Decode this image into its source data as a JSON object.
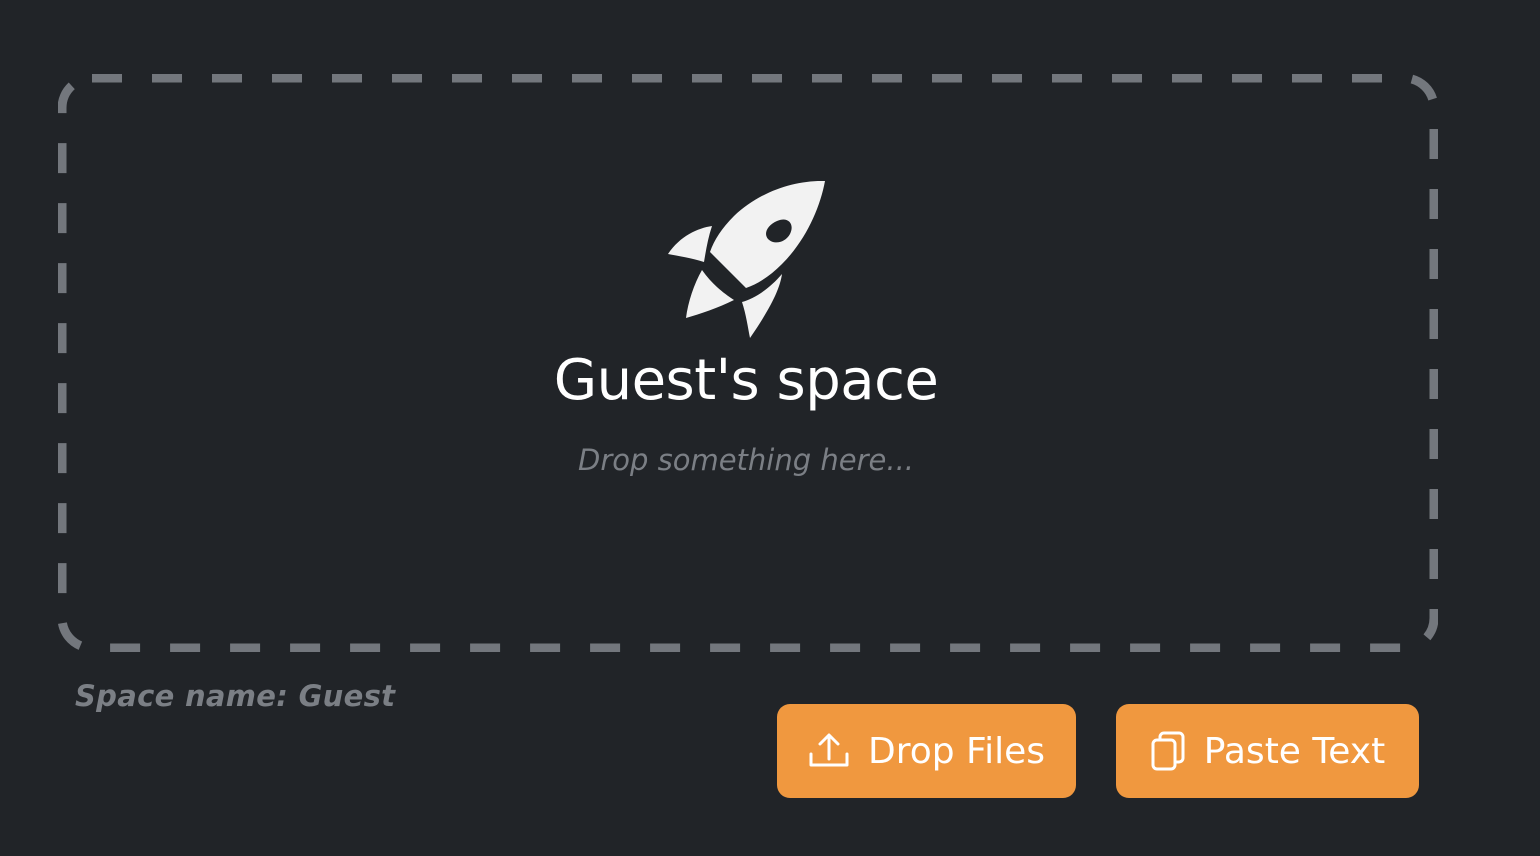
{
  "space": {
    "icon": "rocket-icon",
    "title": "Guest's space",
    "hint": "Drop something here...",
    "name_label": "Space name: Guest"
  },
  "actions": {
    "drop_files": {
      "label": "Drop Files",
      "icon": "upload-icon"
    },
    "paste_text": {
      "label": "Paste Text",
      "icon": "copy-icon"
    }
  },
  "colors": {
    "background": "#212428",
    "dashed_border": "#73777d",
    "accent": "#f0983f",
    "muted_text": "#7b7f85",
    "primary_text": "#ffffff"
  }
}
